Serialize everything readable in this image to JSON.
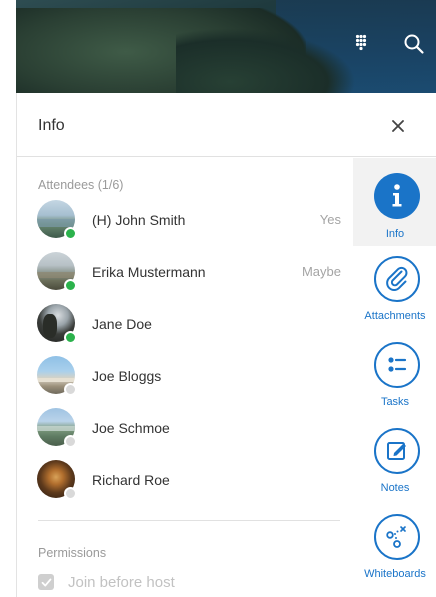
{
  "header": {
    "grid_icon": "grid-dots-icon",
    "search_icon": "search-icon"
  },
  "panel": {
    "title": "Info",
    "close_icon": "close-icon"
  },
  "attendees": {
    "label": "Attendees (1/6)",
    "items": [
      {
        "name": "(H) John Smith",
        "response": "Yes",
        "status": "online"
      },
      {
        "name": "Erika Mustermann",
        "response": "Maybe",
        "status": "online"
      },
      {
        "name": "Jane Doe",
        "response": "",
        "status": "online"
      },
      {
        "name": "Joe Bloggs",
        "response": "",
        "status": "offline"
      },
      {
        "name": "Joe Schmoe",
        "response": "",
        "status": "offline"
      },
      {
        "name": "Richard Roe",
        "response": "",
        "status": "offline"
      }
    ]
  },
  "permissions": {
    "label": "Permissions",
    "join_before_host": {
      "label": "Join before host",
      "checked": true,
      "disabled": true
    }
  },
  "rail": {
    "items": [
      {
        "label": "Info",
        "icon": "info-icon",
        "active": true
      },
      {
        "label": "Attachments",
        "icon": "paperclip-icon",
        "active": false
      },
      {
        "label": "Tasks",
        "icon": "tasks-list-icon",
        "active": false
      },
      {
        "label": "Notes",
        "icon": "notes-edit-icon",
        "active": false
      },
      {
        "label": "Whiteboards",
        "icon": "whiteboard-icon",
        "active": false
      }
    ]
  },
  "colors": {
    "accent": "#1a74c8",
    "status_online": "#2bb24c",
    "status_offline": "#d9d9d9"
  }
}
